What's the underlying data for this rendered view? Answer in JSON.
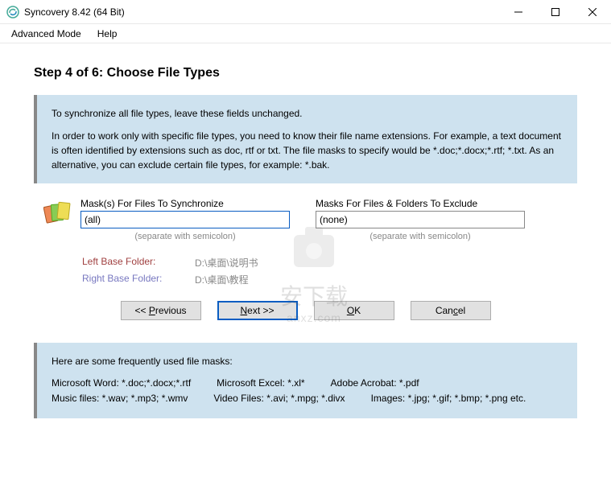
{
  "window": {
    "title": "Syncovery 8.42 (64 Bit)"
  },
  "menu": {
    "advanced": "Advanced Mode",
    "help": "Help"
  },
  "step": {
    "title": "Step 4 of 6: Choose File Types"
  },
  "info": {
    "line1": "To synchronize all file types, leave these fields unchanged.",
    "line2": "In order to work only with specific file types, you need to know their file name extensions. For example, a text document is often identified by extensions such as doc, rtf or txt. The file masks to specify would be *.doc;*.docx;*.rtf; *.txt. As an alternative, you can exclude certain file types, for example: *.bak."
  },
  "masks": {
    "sync_label": "Mask(s) For Files To Synchronize",
    "sync_value": "(all)",
    "exclude_label": "Masks For Files & Folders To Exclude",
    "exclude_value": "(none)",
    "hint": "(separate with semicolon)"
  },
  "paths": {
    "left_label": "Left Base Folder:",
    "left_value": "D:\\桌面\\说明书",
    "right_label": "Right Base Folder:",
    "right_value": "D:\\桌面\\教程"
  },
  "buttons": {
    "previous_pre": "<< ",
    "previous_u": "P",
    "previous_post": "revious",
    "next_u": "N",
    "next_post": "ext >>",
    "ok_u": "O",
    "ok_post": "K",
    "cancel_pre": "Can",
    "cancel_u": "c",
    "cancel_post": "el"
  },
  "hints": {
    "intro": "Here are some frequently used file masks:",
    "word": "Microsoft Word: *.doc;*.docx;*.rtf",
    "excel": "Microsoft Excel: *.xl*",
    "acrobat": "Adobe Acrobat: *.pdf",
    "music": "Music files: *.wav; *.mp3; *.wmv",
    "video": "Video Files: *.avi; *.mpg; *.divx",
    "images": "Images: *.jpg; *.gif; *.bmp; *.png   etc."
  },
  "watermark": {
    "text": "安下载",
    "url": "anxz.com"
  }
}
